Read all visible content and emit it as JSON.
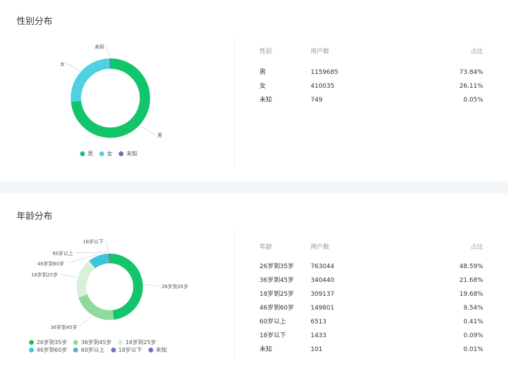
{
  "gender": {
    "title": "性别分布",
    "headers": [
      "性别",
      "用户数",
      "占比"
    ],
    "rows": [
      {
        "label": "男",
        "count": "1159685",
        "pct": "73.84%"
      },
      {
        "label": "女",
        "count": "410035",
        "pct": "26.11%"
      },
      {
        "label": "未知",
        "count": "749",
        "pct": "0.05%"
      }
    ]
  },
  "age": {
    "title": "年龄分布",
    "headers": [
      "年龄",
      "用户数",
      "占比"
    ],
    "rows": [
      {
        "label": "26岁到35岁",
        "count": "763044",
        "pct": "48.59%"
      },
      {
        "label": "36岁到45岁",
        "count": "340440",
        "pct": "21.68%"
      },
      {
        "label": "18岁到25岁",
        "count": "309137",
        "pct": "19.68%"
      },
      {
        "label": "46岁到60岁",
        "count": "149801",
        "pct": "9.54%"
      },
      {
        "label": "60岁以上",
        "count": "6513",
        "pct": "0.41%"
      },
      {
        "label": "18岁以下",
        "count": "1433",
        "pct": "0.09%"
      },
      {
        "label": "未知",
        "count": "101",
        "pct": "0.01%"
      }
    ]
  },
  "chart_data": [
    {
      "type": "pie",
      "title": "性别分布",
      "categories": [
        "男",
        "女",
        "未知"
      ],
      "values": [
        73.84,
        26.11,
        0.05
      ],
      "colors": [
        "#12c46a",
        "#4fd1e2",
        "#6a6fb8"
      ],
      "legend": "bottom"
    },
    {
      "type": "pie",
      "title": "年龄分布",
      "categories": [
        "26岁到35岁",
        "36岁到45岁",
        "18岁到25岁",
        "46岁到60岁",
        "60岁以上",
        "18岁以下",
        "未知"
      ],
      "values": [
        48.59,
        21.68,
        19.68,
        9.54,
        0.41,
        0.09,
        0.01
      ],
      "colors": [
        "#12c46a",
        "#8fd99b",
        "#d6f0da",
        "#3fc3d8",
        "#5aa8e0",
        "#7277bd",
        "#8a5cc7"
      ],
      "legend": "bottom"
    }
  ]
}
